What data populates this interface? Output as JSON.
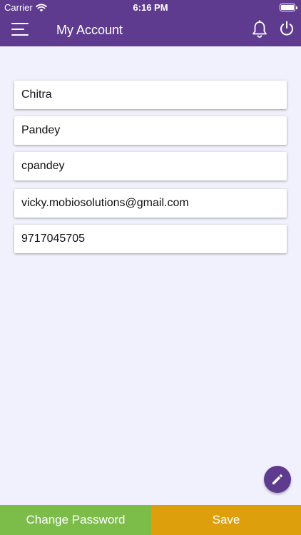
{
  "status_bar": {
    "carrier": "Carrier",
    "time": "6:16 PM"
  },
  "header": {
    "title": "My Account",
    "menu_icon": "menu-icon",
    "bell_icon": "bell-icon",
    "power_icon": "power-icon",
    "bg_color": "#5e3b8f"
  },
  "form": {
    "first_name": "Chitra",
    "last_name": "Pandey",
    "username": "cpandey",
    "email": "vicky.mobiosolutions@gmail.com",
    "phone": "9717045705"
  },
  "fab": {
    "icon": "pencil-icon"
  },
  "footer": {
    "change_password_label": "Change Password",
    "save_label": "Save",
    "change_password_color": "#7cbd49",
    "save_color": "#dd9f0b"
  }
}
